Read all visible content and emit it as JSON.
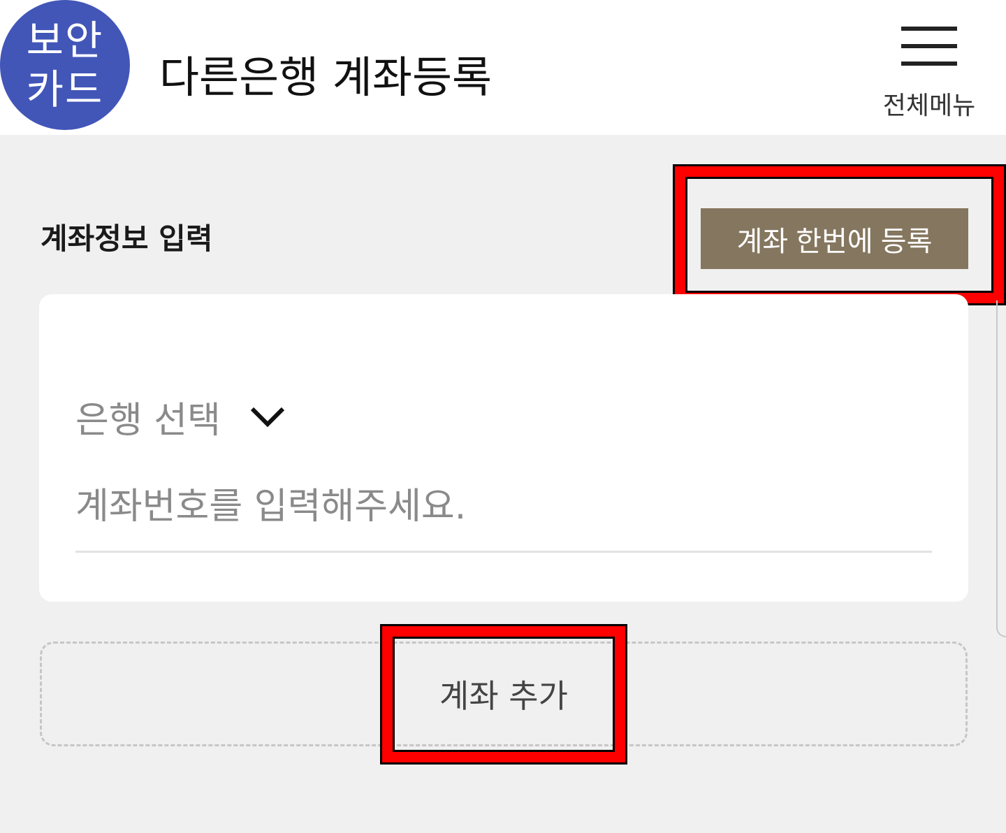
{
  "header": {
    "badge_line1": "보안",
    "badge_line2": "카드",
    "title": "다른은행 계좌등록",
    "menu_label": "전체메뉴"
  },
  "form": {
    "section_title": "계좌정보 입력",
    "bulk_register_label": "계좌 한번에 등록",
    "bank_select_label": "은행 선택",
    "account_placeholder": "계좌번호를 입력해주세요.",
    "account_value": "",
    "add_account_label": "계좌 추가"
  },
  "colors": {
    "badge": "#4256b8",
    "bulk_button": "#85765f",
    "highlight": "#ff0000"
  }
}
